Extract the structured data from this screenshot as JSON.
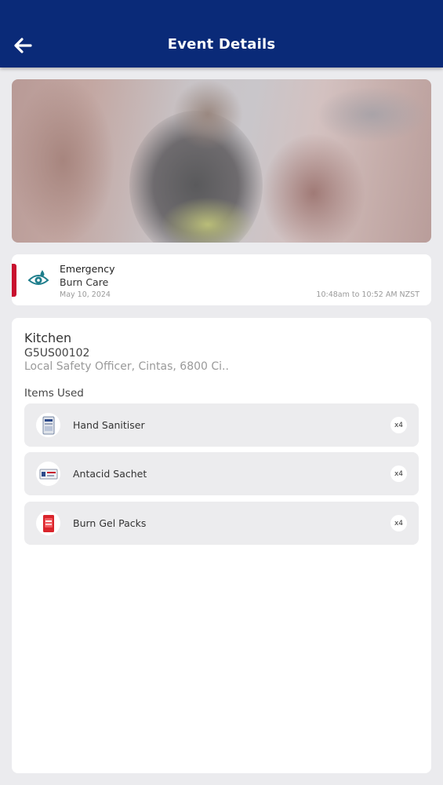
{
  "header": {
    "title": "Event Details",
    "back_icon": "arrow-left-icon",
    "background_color": "#0a2a78"
  },
  "event": {
    "type": "Emergency",
    "name": "Burn Care",
    "date": "May 10, 2024",
    "time_range": "10:48am to 10:52 AM NZST",
    "icon": "eye-drop-icon",
    "accent_color": "#c8102e"
  },
  "location": {
    "name": "Kitchen",
    "code": "G5US00102",
    "address": "Local Safety Officer, Cintas, 6800 Ci..."
  },
  "items_heading": "Items Used",
  "items": [
    {
      "label": "Hand Sanitiser",
      "qty": "x4",
      "icon": "sanitiser-pack-icon"
    },
    {
      "label": "Antacid Sachet",
      "qty": "x4",
      "icon": "sachet-icon"
    },
    {
      "label": "Burn Gel Packs",
      "qty": "x4",
      "icon": "gel-pack-icon"
    }
  ]
}
